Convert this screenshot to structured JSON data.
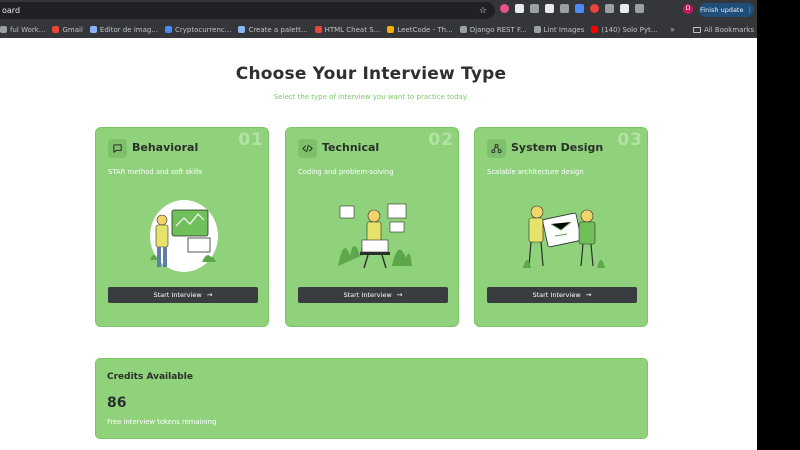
{
  "browser": {
    "url": "oard",
    "finish_update": "Finish update",
    "avatar_letter": "D",
    "bookmarks": [
      {
        "label": "ful Work...",
        "color": "#9aa0a6"
      },
      {
        "label": "Gmail",
        "color": "#e8453c"
      },
      {
        "label": "Editor de imag...",
        "color": "#8ab4f8"
      },
      {
        "label": "Cryptocurrenc...",
        "color": "#4c8bf5"
      },
      {
        "label": "Create a palett...",
        "color": "#8ab4f8"
      },
      {
        "label": "HTML Cheat S...",
        "color": "#e8453c"
      },
      {
        "label": "LeetCode - Th...",
        "color": "#f9ab00"
      },
      {
        "label": "Django REST F...",
        "color": "#9aa0a6"
      },
      {
        "label": "Lint Images",
        "color": "#9aa0a6"
      },
      {
        "label": "(140) Solo Pyt...",
        "color": "#ff0000"
      }
    ],
    "more": "»",
    "all_bookmarks": "All Bookmarks"
  },
  "page": {
    "title": "Choose Your Interview Type",
    "subtitle": "Select the type of interview you want to practice today.",
    "cards": [
      {
        "title": "Behavioral",
        "number": "01",
        "description": "STAR method and soft skills",
        "button": "Start Interview",
        "icon": "chat-icon"
      },
      {
        "title": "Technical",
        "number": "02",
        "description": "Coding and problem-solving",
        "button": "Start Interview",
        "icon": "code-icon"
      },
      {
        "title": "System Design",
        "number": "03",
        "description": "Scalable architecture design",
        "button": "Start Interview",
        "icon": "network-icon"
      }
    ],
    "credits": {
      "title": "Credits Available",
      "value": "86",
      "note": "Free interview tokens remaining"
    }
  },
  "colors": {
    "card_bg": "#8fd27b",
    "button_bg": "#3a3d40",
    "accent_text": "#7cc86a"
  }
}
